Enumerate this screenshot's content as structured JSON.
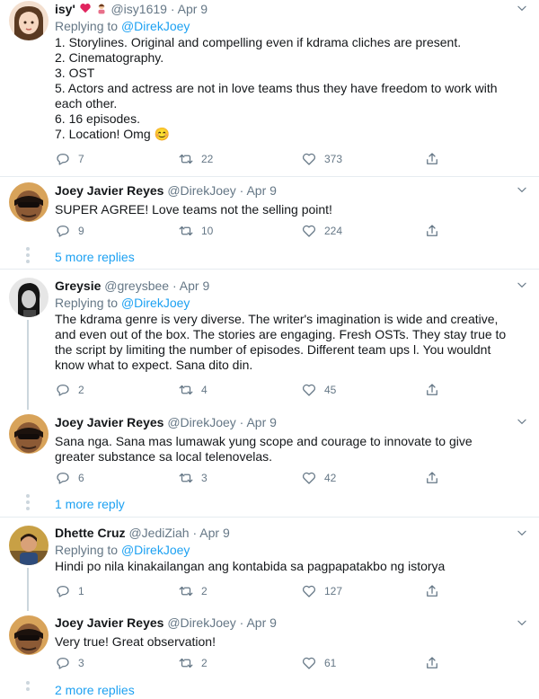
{
  "tweets": [
    {
      "name": "isy'",
      "handle": "@isy1619",
      "date": "Apr 9",
      "replying_label": "Replying to",
      "replying_to": "@DirekJoey",
      "lines": [
        "1. Storylines. Original and compelling even if kdrama cliches are present.",
        "2. Cinematography.",
        "3. OST",
        "5. Actors and actress are not in love teams thus they have  freedom to work with each other.",
        "6. 16 episodes.",
        "7. Location! Omg 😊"
      ],
      "replies": "7",
      "retweets": "22",
      "likes": "373"
    },
    {
      "name": "Joey Javier Reyes",
      "handle": "@DirekJoey",
      "date": "Apr 9",
      "lines": [
        "SUPER AGREE! Love teams not the selling point!"
      ],
      "replies": "9",
      "retweets": "10",
      "likes": "224"
    },
    {
      "name": "Greysie",
      "handle": "@greysbee",
      "date": "Apr 9",
      "replying_label": "Replying to",
      "replying_to": "@DirekJoey",
      "lines": [
        "The kdrama genre is very diverse. The writer's imagination is wide and creative, and even out of the box. The stories are engaging. Fresh OSTs. They stay true to the script by limiting the number of episodes. Different team ups l. You wouldnt know what to expect. Sana dito din."
      ],
      "replies": "2",
      "retweets": "4",
      "likes": "45"
    },
    {
      "name": "Joey Javier Reyes",
      "handle": "@DirekJoey",
      "date": "Apr 9",
      "lines": [
        "Sana nga.  Sana mas lumawak yung scope and courage to innovate to give greater substance sa local telenovelas."
      ],
      "replies": "6",
      "retweets": "3",
      "likes": "42"
    },
    {
      "name": "Dhette Cruz",
      "handle": "@JediZiah",
      "date": "Apr 9",
      "replying_label": "Replying to",
      "replying_to": "@DirekJoey",
      "lines": [
        "Hindi po nila kinakailangan ang kontabida sa pagpapatakbo ng istorya"
      ],
      "replies": "1",
      "retweets": "2",
      "likes": "127"
    },
    {
      "name": "Joey Javier Reyes",
      "handle": "@DirekJoey",
      "date": "Apr 9",
      "lines": [
        "Very true! Great observation!"
      ],
      "replies": "3",
      "retweets": "2",
      "likes": "61"
    }
  ],
  "more_replies": [
    "5 more replies",
    "1 more reply",
    "2 more replies"
  ],
  "colors": {
    "accent": "#1da1f2",
    "muted": "#657786",
    "heart_badge": "#e0245e"
  },
  "icons": [
    "reply-icon",
    "retweet-icon",
    "like-icon",
    "share-icon",
    "chevron-down-icon",
    "heart-icon",
    "avatar"
  ]
}
